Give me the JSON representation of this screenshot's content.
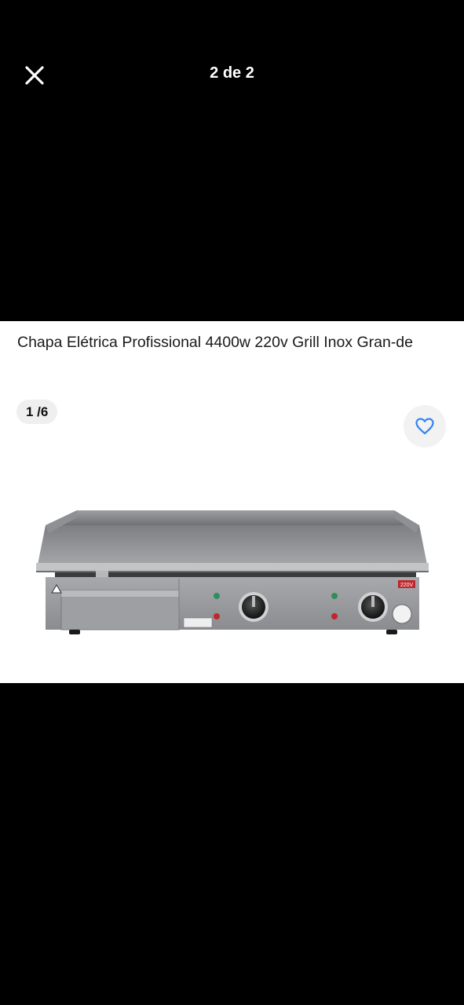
{
  "viewer": {
    "counter": "2 de 2",
    "close_icon": "close-icon"
  },
  "product": {
    "title": "Chapa Elétrica Profissional 4400w 220v Grill Inox Gran-de",
    "image_counter": "1 /6",
    "favorite_icon": "heart-outline-icon",
    "image_alt": "stainless steel electric griddle",
    "voltage_label": "220V",
    "accent_color": "#3483fa"
  }
}
